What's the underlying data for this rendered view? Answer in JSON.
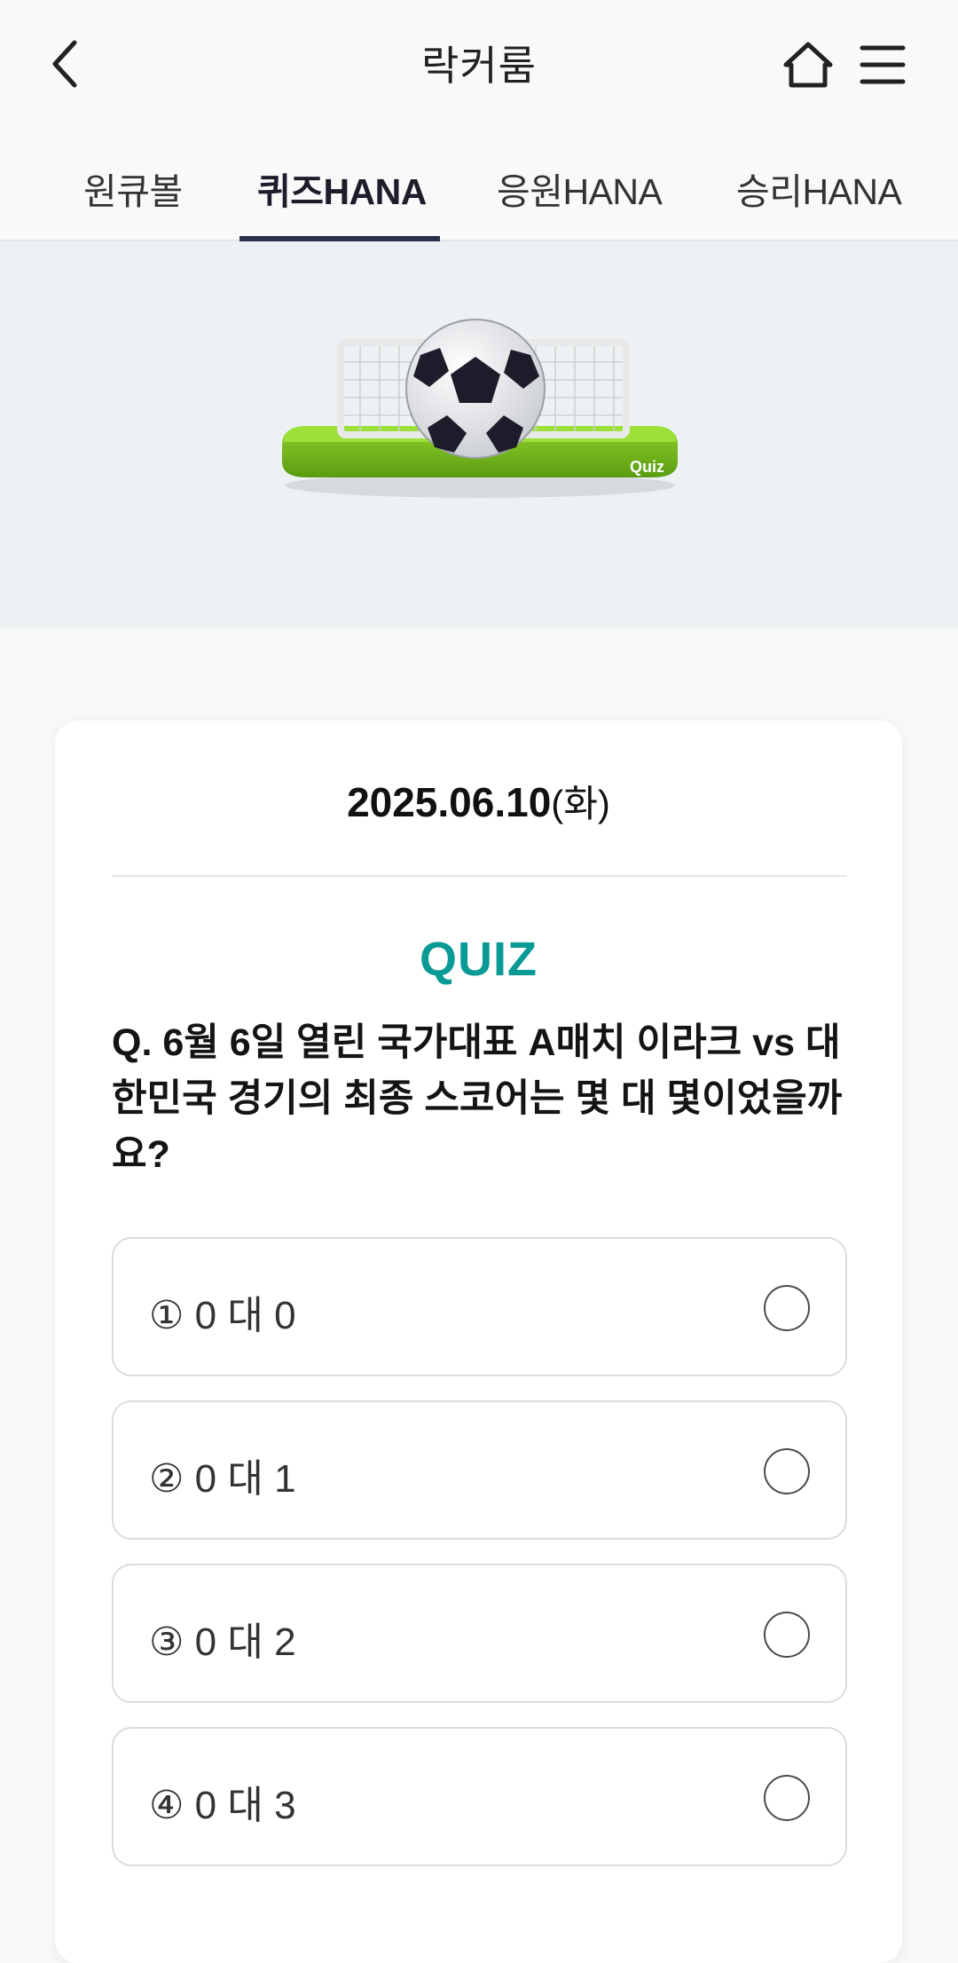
{
  "header": {
    "title": "락커룸",
    "back_icon": "chevron-left-icon",
    "home_icon": "home-icon",
    "menu_icon": "hamburger-menu-icon"
  },
  "tabs": [
    {
      "label": "원큐볼",
      "active": false
    },
    {
      "label": "퀴즈HANA",
      "active": true
    },
    {
      "label": "응원HANA",
      "active": false
    },
    {
      "label": "승리HANA",
      "active": false
    }
  ],
  "banner": {
    "illustration_badge": "Quiz"
  },
  "quiz": {
    "date": "2025.06.10",
    "day_of_week": "(화)",
    "label": "QUIZ",
    "question": "Q. 6월 6일 열린 국가대표 A매치 이라크 vs 대한민국 경기의 최종 스코어는 몇 대 몇이었을까요?",
    "options": [
      {
        "label": "① 0 대 0",
        "selected": false
      },
      {
        "label": "② 0 대 1",
        "selected": false
      },
      {
        "label": "③ 0 대 2",
        "selected": false
      },
      {
        "label": "④ 0 대 3",
        "selected": false
      }
    ]
  },
  "colors": {
    "accent": "#0a9a96",
    "tab_indicator": "#2a3149",
    "banner_bg": "#eef1f4",
    "page_bg": "#f8f9f9"
  }
}
